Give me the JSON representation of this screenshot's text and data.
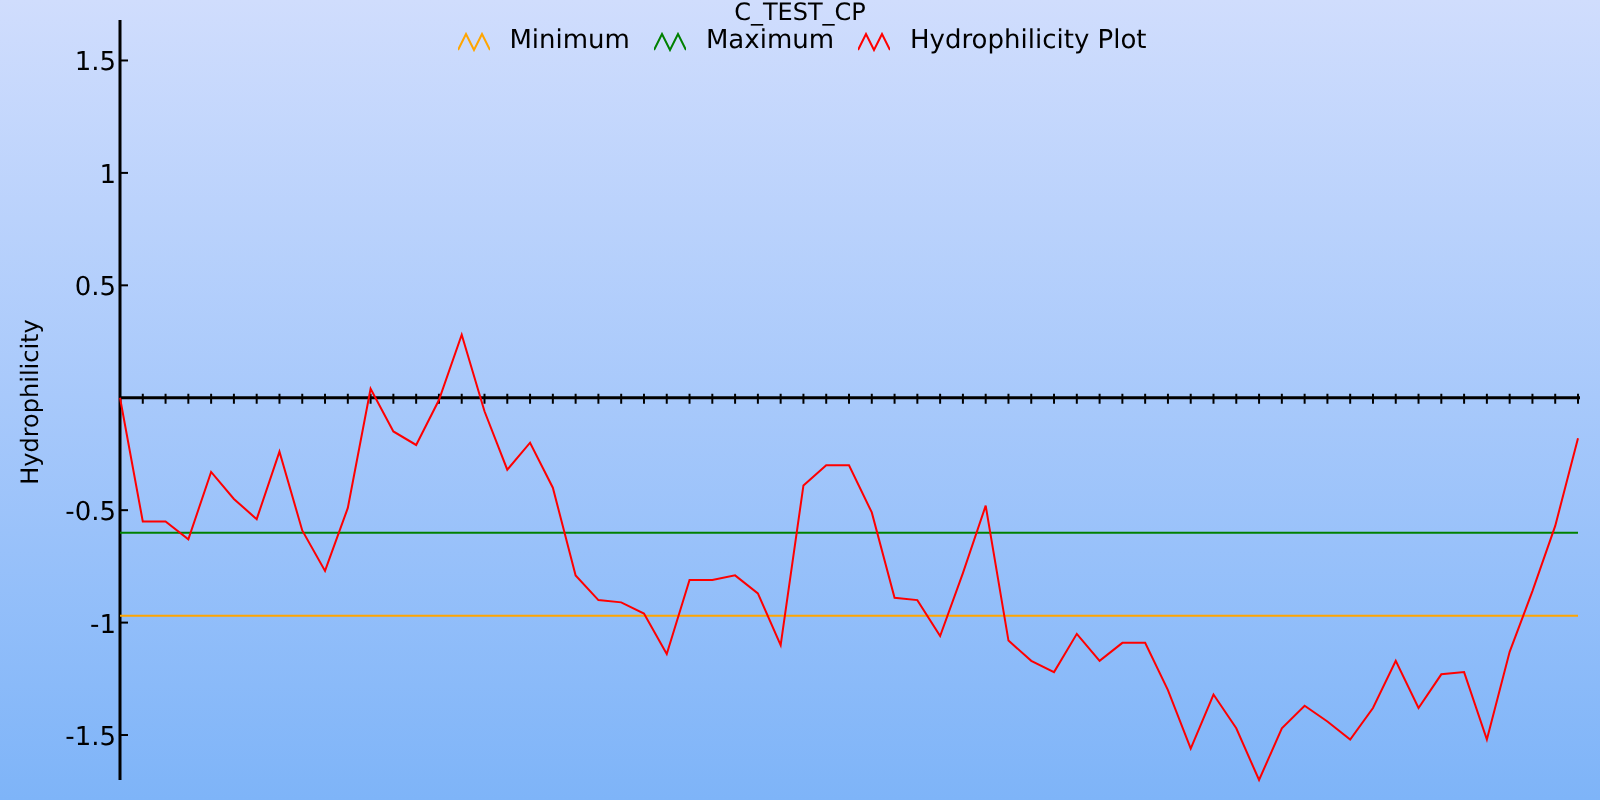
{
  "chart_data": {
    "type": "line",
    "title": "C_TEST_CP",
    "ylabel": "Hydrophilicity",
    "ylim": [
      -1.7,
      1.68
    ],
    "yticks": [
      -1.5,
      -1,
      -0.5,
      0.5,
      1,
      1.5
    ],
    "legend": true,
    "series": [
      {
        "name": "Minimum",
        "color": "#ffa500",
        "values": [
          -0.97,
          -0.97,
          -0.97,
          -0.97,
          -0.97,
          -0.97,
          -0.97,
          -0.97,
          -0.97,
          -0.97,
          -0.97,
          -0.97,
          -0.97,
          -0.97,
          -0.97,
          -0.97,
          -0.97,
          -0.97,
          -0.97,
          -0.97,
          -0.97,
          -0.97,
          -0.97,
          -0.97,
          -0.97,
          -0.97,
          -0.97,
          -0.97,
          -0.97,
          -0.97,
          -0.97,
          -0.97,
          -0.97,
          -0.97,
          -0.97,
          -0.97,
          -0.97,
          -0.97,
          -0.97,
          -0.97,
          -0.97,
          -0.97,
          -0.97,
          -0.97,
          -0.97,
          -0.97,
          -0.97,
          -0.97,
          -0.97,
          -0.97,
          -0.97,
          -0.97,
          -0.97,
          -0.97,
          -0.97,
          -0.97,
          -0.97,
          -0.97,
          -0.97,
          -0.97,
          -0.97,
          -0.97,
          -0.97,
          -0.97,
          -0.97
        ]
      },
      {
        "name": "Maximum",
        "color": "#008000",
        "values": [
          -0.6,
          -0.6,
          -0.6,
          -0.6,
          -0.6,
          -0.6,
          -0.6,
          -0.6,
          -0.6,
          -0.6,
          -0.6,
          -0.6,
          -0.6,
          -0.6,
          -0.6,
          -0.6,
          -0.6,
          -0.6,
          -0.6,
          -0.6,
          -0.6,
          -0.6,
          -0.6,
          -0.6,
          -0.6,
          -0.6,
          -0.6,
          -0.6,
          -0.6,
          -0.6,
          -0.6,
          -0.6,
          -0.6,
          -0.6,
          -0.6,
          -0.6,
          -0.6,
          -0.6,
          -0.6,
          -0.6,
          -0.6,
          -0.6,
          -0.6,
          -0.6,
          -0.6,
          -0.6,
          -0.6,
          -0.6,
          -0.6,
          -0.6,
          -0.6,
          -0.6,
          -0.6,
          -0.6,
          -0.6,
          -0.6,
          -0.6,
          -0.6,
          -0.6,
          -0.6,
          -0.6,
          -0.6,
          -0.6,
          -0.6,
          -0.6
        ]
      },
      {
        "name": "Hydrophilicity Plot",
        "color": "#ff0000",
        "values": [
          0,
          -0.55,
          -0.55,
          -0.63,
          -0.33,
          -0.45,
          -0.54,
          -0.24,
          -0.59,
          -0.77,
          -0.49,
          0.04,
          -0.15,
          -0.21,
          -0.01,
          0.28,
          -0.06,
          -0.32,
          -0.2,
          -0.4,
          -0.79,
          -0.9,
          -0.91,
          -0.96,
          -1.14,
          -0.81,
          -0.81,
          -0.79,
          -0.87,
          -1.1,
          -0.39,
          -0.3,
          -0.3,
          -0.51,
          -0.89,
          -0.9,
          -1.06,
          -0.78,
          -0.48,
          -1.08,
          -1.17,
          -1.22,
          -1.05,
          -1.17,
          -1.09,
          -1.09,
          -1.3,
          -1.56,
          -1.32,
          -1.47,
          -1.7,
          -1.47,
          -1.37,
          -1.44,
          -1.52,
          -1.38,
          -1.17,
          -1.38,
          -1.23,
          -1.22,
          -1.52,
          -1.13,
          -0.86,
          -0.57,
          -0.18
        ]
      }
    ]
  }
}
